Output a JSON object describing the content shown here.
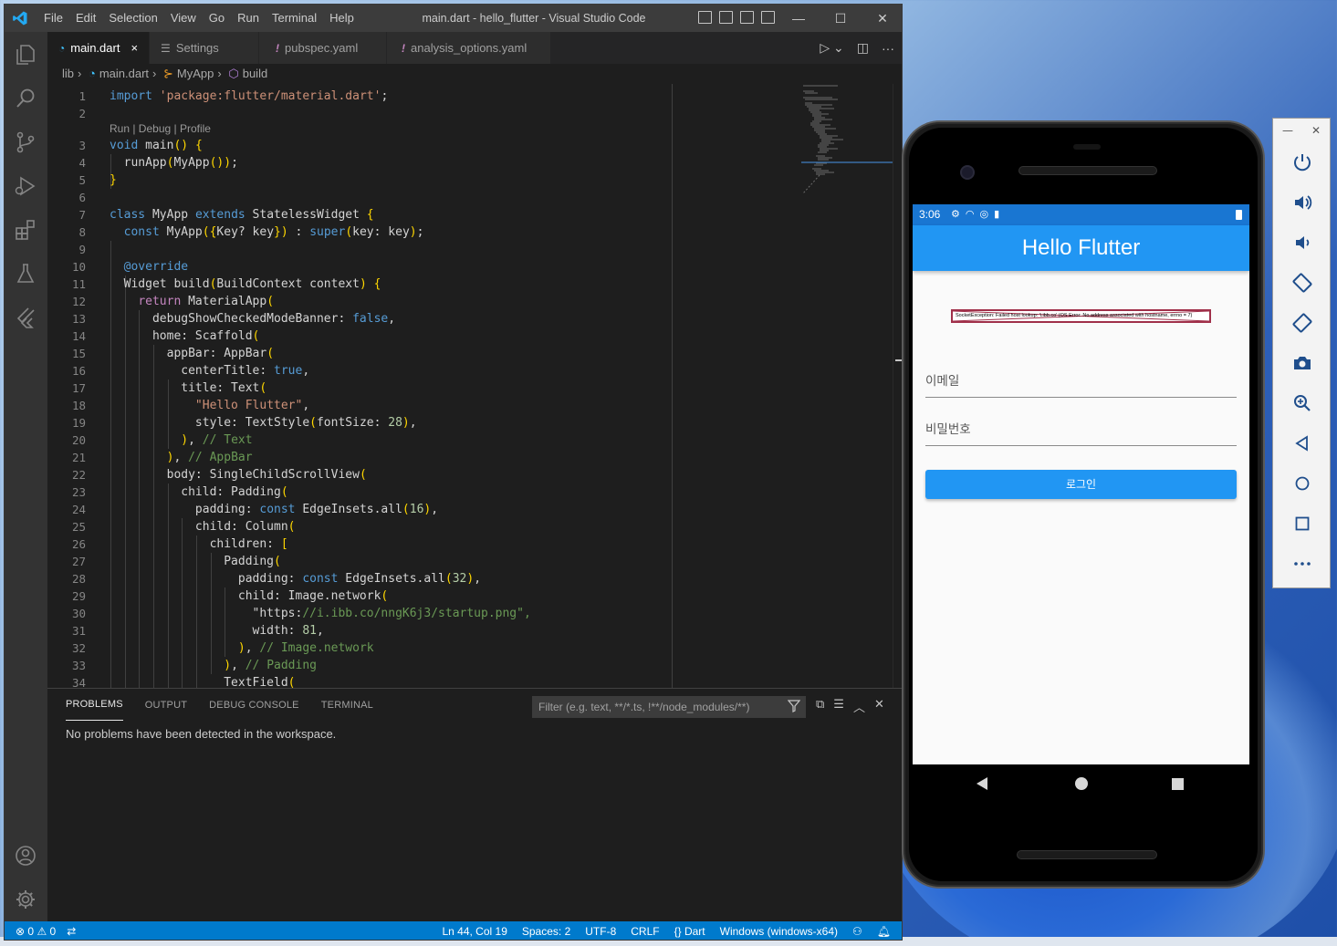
{
  "window": {
    "title": "main.dart - hello_flutter - Visual Studio Code",
    "menu": [
      "File",
      "Edit",
      "Selection",
      "View",
      "Go",
      "Run",
      "Terminal",
      "Help"
    ]
  },
  "tabs": [
    {
      "label": "main.dart",
      "icon": "dart-file-icon",
      "active": true,
      "close": "×"
    },
    {
      "label": "Settings",
      "icon": "settings-lines-icon",
      "active": false
    },
    {
      "label": "pubspec.yaml",
      "icon": "exclamation-icon",
      "active": false
    },
    {
      "label": "analysis_options.yaml",
      "icon": "exclamation-icon",
      "active": false
    }
  ],
  "breadcrumb": [
    "lib",
    "main.dart",
    "MyApp",
    "build"
  ],
  "codelens": "Run | Debug | Profile",
  "code_lines": [
    {
      "n": "1",
      "t": "import 'package:flutter/material.dart';"
    },
    {
      "n": "2",
      "t": ""
    },
    {
      "n": "3",
      "t": "void main() {"
    },
    {
      "n": "4",
      "t": "  runApp(MyApp());"
    },
    {
      "n": "5",
      "t": "}"
    },
    {
      "n": "6",
      "t": ""
    },
    {
      "n": "7",
      "t": "class MyApp extends StatelessWidget {"
    },
    {
      "n": "8",
      "t": "  const MyApp({Key? key}) : super(key: key);"
    },
    {
      "n": "9",
      "t": ""
    },
    {
      "n": "10",
      "t": "  @override"
    },
    {
      "n": "11",
      "t": "  Widget build(BuildContext context) {"
    },
    {
      "n": "12",
      "t": "    return MaterialApp("
    },
    {
      "n": "13",
      "t": "      debugShowCheckedModeBanner: false,"
    },
    {
      "n": "14",
      "t": "      home: Scaffold("
    },
    {
      "n": "15",
      "t": "        appBar: AppBar("
    },
    {
      "n": "16",
      "t": "          centerTitle: true,"
    },
    {
      "n": "17",
      "t": "          title: Text("
    },
    {
      "n": "18",
      "t": "            \"Hello Flutter\","
    },
    {
      "n": "19",
      "t": "            style: TextStyle(fontSize: 28),"
    },
    {
      "n": "20",
      "t": "          ), // Text"
    },
    {
      "n": "21",
      "t": "        ), // AppBar"
    },
    {
      "n": "22",
      "t": "        body: SingleChildScrollView("
    },
    {
      "n": "23",
      "t": "          child: Padding("
    },
    {
      "n": "24",
      "t": "            padding: const EdgeInsets.all(16),"
    },
    {
      "n": "25",
      "t": "            child: Column("
    },
    {
      "n": "26",
      "t": "              children: ["
    },
    {
      "n": "27",
      "t": "                Padding("
    },
    {
      "n": "28",
      "t": "                  padding: const EdgeInsets.all(32),"
    },
    {
      "n": "29",
      "t": "                  child: Image.network("
    },
    {
      "n": "30",
      "t": "                    \"https://i.ibb.co/nngK6j3/startup.png\","
    },
    {
      "n": "31",
      "t": "                    width: 81,"
    },
    {
      "n": "32",
      "t": "                  ), // Image.network"
    },
    {
      "n": "33",
      "t": "                ), // Padding"
    },
    {
      "n": "34",
      "t": "                TextField("
    }
  ],
  "panel": {
    "tabs": [
      "PROBLEMS",
      "OUTPUT",
      "DEBUG CONSOLE",
      "TERMINAL"
    ],
    "filter_placeholder": "Filter (e.g. text, **/*.ts, !**/node_modules/**)",
    "message": "No problems have been detected in the workspace."
  },
  "statusbar": {
    "errors": "0",
    "warnings": "0",
    "position": "Ln 44, Col 19",
    "spaces": "Spaces: 2",
    "encoding": "UTF-8",
    "eol": "CRLF",
    "language": "Dart",
    "platform": "Windows (windows-x64)"
  },
  "phone": {
    "time": "3:06",
    "app_title": "Hello Flutter",
    "image_error": "SocketException: Failed host lookup: 'i.ibb.co' (OS Error: No address associated with hostname, errno = 7)",
    "email_label": "이메일",
    "password_label": "비밀번호",
    "login_label": "로그인"
  },
  "colors": {
    "accent": "#007acc",
    "flutter_blue": "#2196f3",
    "status_blue": "#1976d2"
  }
}
